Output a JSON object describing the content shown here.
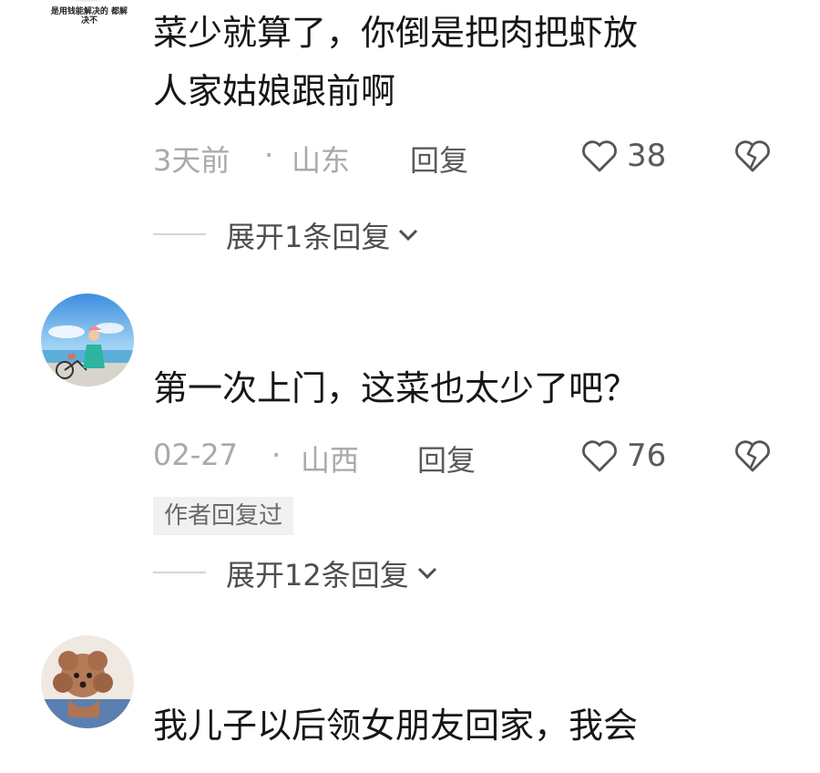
{
  "comments": [
    {
      "avatar_text": "是用钱能解决的 都解决不",
      "text_line1": "菜少就算了，你倒是把肉把虾放",
      "text_line2": "人家姑娘跟前啊",
      "time": "3天前",
      "separator": "·",
      "location": "山东",
      "reply_label": "回复",
      "like_count": "38",
      "expand_label": "展开1条回复"
    },
    {
      "text_line1": "第一次上门，这菜也太少了吧？",
      "time": "02-27",
      "separator": "·",
      "location": "山西",
      "reply_label": "回复",
      "like_count": "76",
      "author_badge": "作者回复过",
      "expand_label": "展开12条回复"
    },
    {
      "text_line1": "我儿子以后领女朋友回家，我会"
    }
  ],
  "icons": {
    "like": "heart-outline-icon",
    "dislike": "broken-heart-icon",
    "expand": "chevron-down-icon"
  },
  "colors": {
    "text": "#161616",
    "meta": "#a9a9a9",
    "action": "#5a5a5a",
    "badge_bg": "#f1f1f1"
  }
}
